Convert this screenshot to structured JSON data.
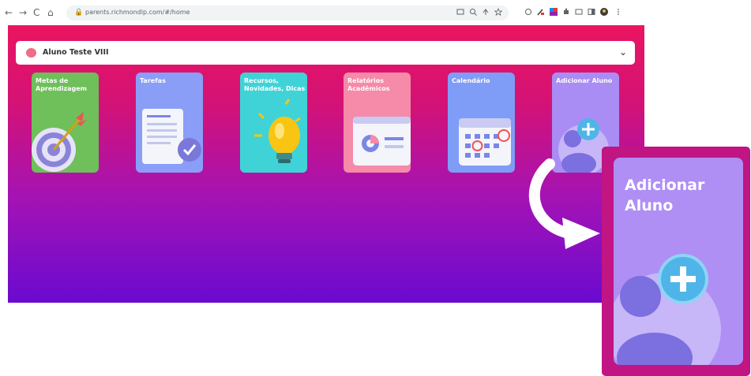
{
  "browser": {
    "back": "←",
    "forward": "→",
    "reload": "C",
    "home": "⌂",
    "lock": "🔒",
    "url": "parents.richmondlp.com/#/home"
  },
  "student_selector": {
    "name": "Aluno Teste VIII",
    "chevron": "⌄"
  },
  "cards": [
    {
      "label": "Metas de Aprendizagem",
      "icon": "target-icon",
      "color": "#6fbf5a"
    },
    {
      "label": "Tarefas",
      "icon": "clipboard-check-icon",
      "color": "#8a9ef8"
    },
    {
      "label": "Recursos, Novidades, Dicas",
      "icon": "lightbulb-icon",
      "color": "#3fd3d8"
    },
    {
      "label": "Relatórios Acadêmicos",
      "icon": "report-chart-icon",
      "color": "#f58aa9"
    },
    {
      "label": "Calendário",
      "icon": "calendar-icon",
      "color": "#7f9cf7"
    },
    {
      "label": "Adicionar Aluno",
      "icon": "add-user-icon",
      "color": "#a98cf4"
    }
  ],
  "callout": {
    "label": "Adicionar Aluno",
    "icon": "add-user-icon",
    "arrow_icon": "curved-arrow-icon"
  },
  "colors": {
    "gradient_top": "#ea1560",
    "gradient_bottom": "#6a0ad0",
    "callout_border": "#c01583"
  }
}
